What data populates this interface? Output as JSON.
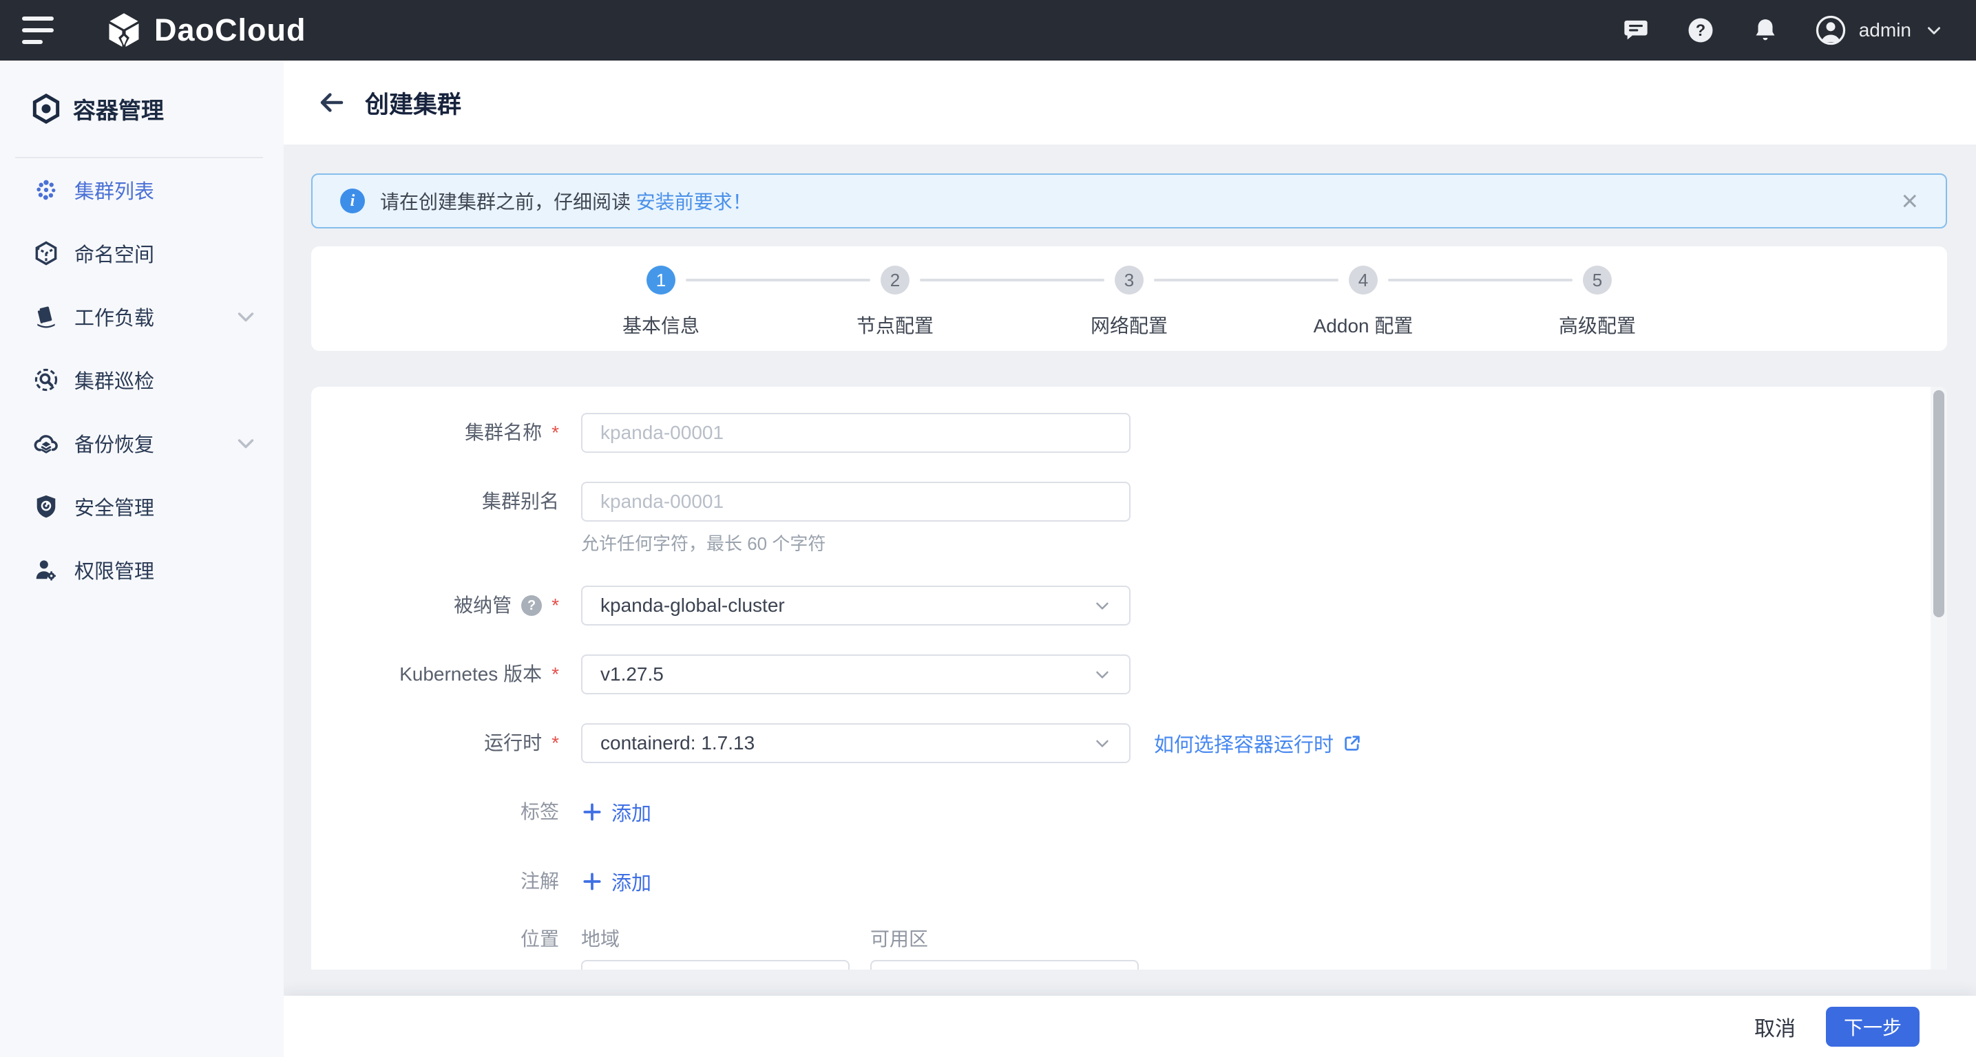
{
  "topbar": {
    "brand": "DaoCloud",
    "user": "admin"
  },
  "sidebar": {
    "group_title": "容器管理",
    "items": [
      {
        "label": "集群列表",
        "selected": true,
        "expandable": false
      },
      {
        "label": "命名空间",
        "selected": false,
        "expandable": false
      },
      {
        "label": "工作负载",
        "selected": false,
        "expandable": true
      },
      {
        "label": "集群巡检",
        "selected": false,
        "expandable": false
      },
      {
        "label": "备份恢复",
        "selected": false,
        "expandable": true
      },
      {
        "label": "安全管理",
        "selected": false,
        "expandable": false
      },
      {
        "label": "权限管理",
        "selected": false,
        "expandable": false
      }
    ]
  },
  "header": {
    "title": "创建集群"
  },
  "banner": {
    "text": "请在创建集群之前，仔细阅读 ",
    "link": "安装前要求！",
    "close": "×"
  },
  "stepper": {
    "steps": [
      {
        "num": "1",
        "label": "基本信息",
        "active": true
      },
      {
        "num": "2",
        "label": "节点配置",
        "active": false
      },
      {
        "num": "3",
        "label": "网络配置",
        "active": false
      },
      {
        "num": "4",
        "label": "Addon 配置",
        "active": false
      },
      {
        "num": "5",
        "label": "高级配置",
        "active": false
      }
    ]
  },
  "form": {
    "required_mark": "*",
    "cluster_name": {
      "label": "集群名称",
      "placeholder": "kpanda-00001"
    },
    "cluster_alias": {
      "label": "集群别名",
      "placeholder": "kpanda-00001",
      "hint": "允许任何字符，最长 60 个字符"
    },
    "managed_by": {
      "label": "被纳管",
      "help": "?",
      "value": "kpanda-global-cluster"
    },
    "k8s_version": {
      "label": "Kubernetes 版本",
      "value": "v1.27.5"
    },
    "runtime": {
      "label": "运行时",
      "value": "containerd: 1.7.13",
      "link": "如何选择容器运行时"
    },
    "labels": {
      "label": "标签",
      "add": "添加"
    },
    "annotations": {
      "label": "注解",
      "add": "添加"
    },
    "location": {
      "label": "位置",
      "region_label": "地域",
      "zone_label": "可用区"
    }
  },
  "footer": {
    "cancel": "取消",
    "next": "下一步"
  },
  "colors": {
    "accent": "#3a6be0",
    "link": "#4a90e9",
    "step_active": "#4598e9",
    "topbar_bg": "#282c34"
  }
}
